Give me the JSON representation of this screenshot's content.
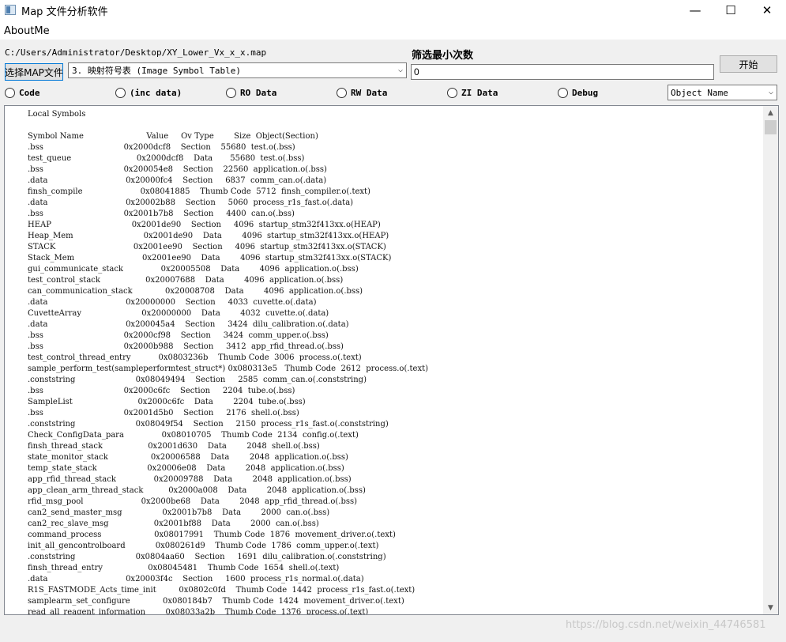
{
  "window": {
    "title": "Map 文件分析软件",
    "minimize": "—",
    "maximize": "☐",
    "close": "✕"
  },
  "menu": {
    "about": "AboutMe"
  },
  "file_path": "C:/Users/Administrator/Desktop/XY_Lower_Vx_x_x.map",
  "buttons": {
    "select_map": "选择MAP文件",
    "start": "开始"
  },
  "type_select": {
    "value": "3. 映射符号表 (Image Symbol Table)"
  },
  "filter": {
    "label": "筛选最小次数",
    "value": "0"
  },
  "radios": [
    {
      "label": "Code",
      "selected": false
    },
    {
      "label": "(inc data)",
      "selected": false
    },
    {
      "label": "RO Data",
      "selected": false
    },
    {
      "label": "RW Data",
      "selected": false
    },
    {
      "label": "ZI Data",
      "selected": false
    },
    {
      "label": "Debug",
      "selected": false
    }
  ],
  "object_select": {
    "value": "Object Name"
  },
  "output": {
    "section_title": "Local Symbols",
    "header": "Symbol Name                         Value     Ov Type        Size  Object(Section)",
    "rows": [
      ".bss                                0x2000dcf8    Section    55680  test.o(.bss)",
      "test_queue                          0x2000dcf8    Data       55680  test.o(.bss)",
      ".bss                                0x200054e8    Section    22560  application.o(.bss)",
      ".data                               0x20000fc4    Section     6837  comm_can.o(.data)",
      "finsh_compile                       0x08041885    Thumb Code  5712  finsh_compiler.o(.text)",
      ".data                               0x20002b88    Section     5060  process_r1s_fast.o(.data)",
      ".bss                                0x2001b7b8    Section     4400  can.o(.bss)",
      "HEAP                                0x2001de90    Section     4096  startup_stm32f413xx.o(HEAP)",
      "Heap_Mem                            0x2001de90    Data        4096  startup_stm32f413xx.o(HEAP)",
      "STACK                               0x2001ee90    Section     4096  startup_stm32f413xx.o(STACK)",
      "Stack_Mem                           0x2001ee90    Data        4096  startup_stm32f413xx.o(STACK)",
      "gui_communicate_stack               0x20005508    Data        4096  application.o(.bss)",
      "test_control_stack                  0x20007688    Data        4096  application.o(.bss)",
      "can_communication_stack             0x20008708    Data        4096  application.o(.bss)",
      ".data                               0x20000000    Section     4033  cuvette.o(.data)",
      "CuvetteArray                        0x20000000    Data        4032  cuvette.o(.data)",
      ".data                               0x200045a4    Section     3424  dilu_calibration.o(.data)",
      ".bss                                0x2000cf98    Section     3424  comm_upper.o(.bss)",
      ".bss                                0x2000b988    Section     3412  app_rfid_thread.o(.bss)",
      "test_control_thread_entry           0x0803236b    Thumb Code  3006  process.o(.text)",
      "sample_perform_test(sampleperformtest_struct*) 0x080313e5   Thumb Code  2612  process.o(.text)",
      ".conststring                        0x08049494    Section     2585  comm_can.o(.conststring)",
      ".bss                                0x2000c6fc    Section     2204  tube.o(.bss)",
      "SampleList                          0x2000c6fc    Data        2204  tube.o(.bss)",
      ".bss                                0x2001d5b0    Section     2176  shell.o(.bss)",
      ".conststring                        0x08049f54    Section     2150  process_r1s_fast.o(.conststring)",
      "Check_ConfigData_para               0x08010705    Thumb Code  2134  config.o(.text)",
      "finsh_thread_stack                  0x2001d630    Data        2048  shell.o(.bss)",
      "state_monitor_stack                 0x20006588    Data        2048  application.o(.bss)",
      "temp_state_stack                    0x20006e08    Data        2048  application.o(.bss)",
      "app_rfid_thread_stack               0x20009788    Data        2048  application.o(.bss)",
      "app_clean_arm_thread_stack          0x2000a008    Data        2048  application.o(.bss)",
      "rfid_msg_pool                       0x2000be68    Data        2048  app_rfid_thread.o(.bss)",
      "can2_send_master_msg                0x2001b7b8    Data        2000  can.o(.bss)",
      "can2_rec_slave_msg                  0x2001bf88    Data        2000  can.o(.bss)",
      "command_process                     0x08017991    Thumb Code  1876  movement_driver.o(.text)",
      "init_all_gencontrolboard            0x080261d9    Thumb Code  1786  comm_upper.o(.text)",
      ".conststring                        0x0804aa60    Section     1691  dilu_calibration.o(.conststring)",
      "finsh_thread_entry                  0x08045481    Thumb Code  1654  shell.o(.text)",
      ".data                               0x20003f4c    Section     1600  process_r1s_normal.o(.data)",
      "R1S_FASTMODE_Acts_time_init         0x0802c0fd    Thumb Code  1442  process_r1s_fast.o(.text)",
      "samplearm_set_configure             0x080184b7    Thumb Code  1424  movement_driver.o(.text)",
      "read_all_reagent_information        0x08033a2b    Thumb Code  1376  process.o(.text)"
    ]
  },
  "watermark": "https://blog.csdn.net/weixin_44746581"
}
